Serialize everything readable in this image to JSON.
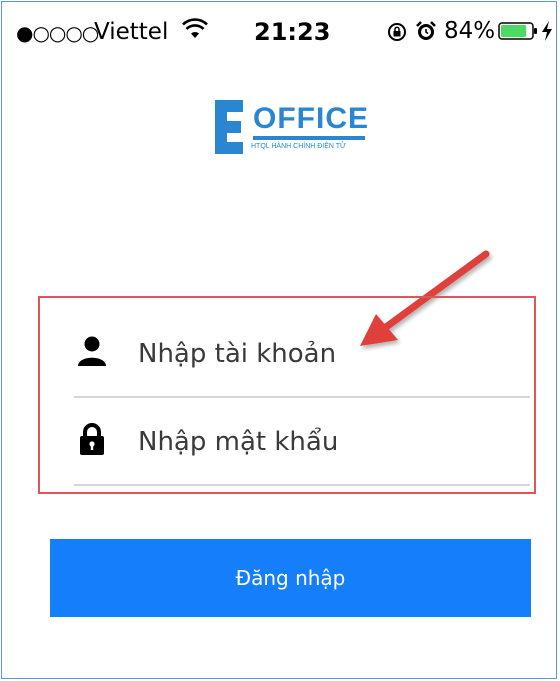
{
  "status_bar": {
    "signal": "●○○○○",
    "carrier": "Viettel",
    "wifi_icon": "wifi-icon",
    "time": "21:23",
    "orientation_lock_icon": "orientation-lock-icon",
    "alarm_icon": "alarm-icon",
    "battery_percent": "84%",
    "battery_level": 0.84,
    "battery_icon": "battery-icon",
    "charging_icon": "charging-bolt-icon"
  },
  "logo": {
    "letter": "E",
    "word": "OFFICE",
    "tagline": "HTQL HÀNH CHÍNH ĐIỆN TỬ",
    "color": "#2b86d1"
  },
  "login_form": {
    "username": {
      "icon": "user-icon",
      "placeholder": "Nhập tài khoản",
      "value": ""
    },
    "password": {
      "icon": "lock-icon",
      "placeholder": "Nhập mật khẩu",
      "value": ""
    },
    "highlight_color": "#e05557"
  },
  "login_button": {
    "label": "Đăng nhập",
    "color": "#147efb"
  },
  "annotation": {
    "arrow_icon": "red-arrow-icon",
    "color": "#e0403a"
  }
}
